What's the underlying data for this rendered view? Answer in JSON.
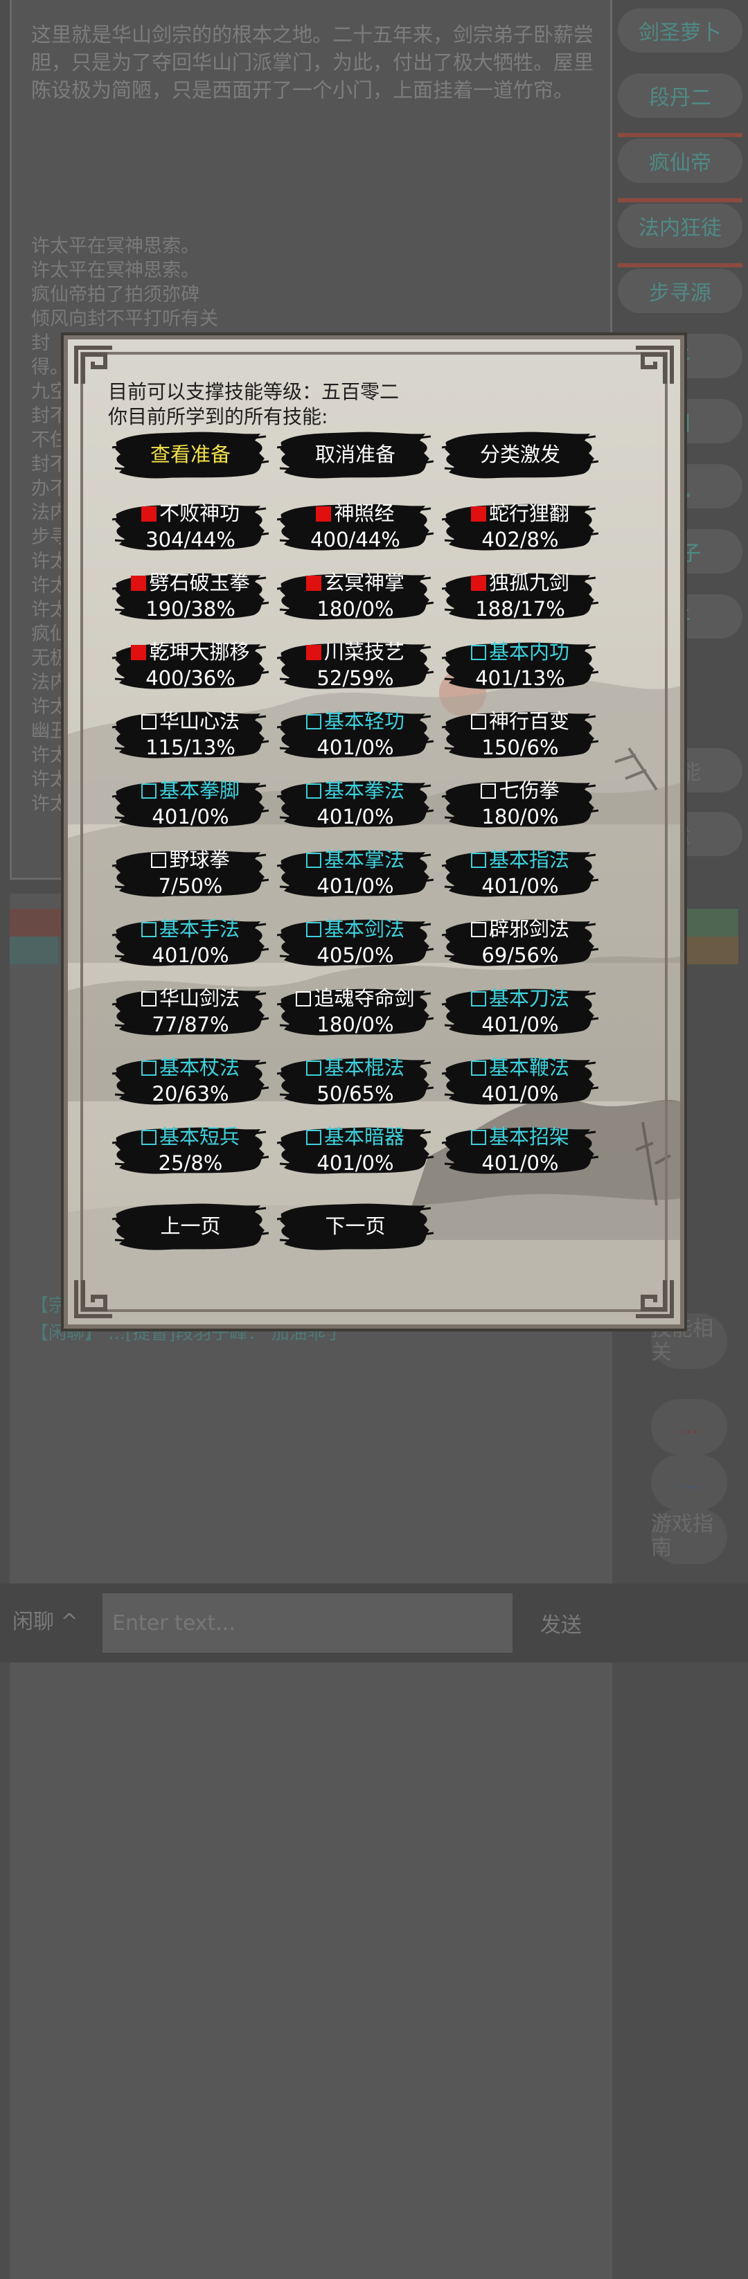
{
  "story": {
    "description": "这里就是华山剑宗的的根本之地。二十五年来，剑宗弟子卧薪尝胆，只是为了夺回华山门派掌门，为此，付出了极大牺牲。屋里陈设极为简陋，只是西面开了一个小门，上面挂着一道竹帘。",
    "log": [
      {
        "text": "许太平在冥神思索。",
        "tone": "normal"
      },
      {
        "text": "许太平在冥神思索。",
        "tone": "normal"
      },
      {
        "text": "疯仙帝拍了拍须弥碑",
        "tone": "normal"
      },
      {
        "text": "倾风向封不平打听有关",
        "tone": "normal"
      },
      {
        "text": "封",
        "tone": "normal"
      },
      {
        "text": "得。",
        "tone": "normal"
      },
      {
        "text": "九空",
        "tone": "normal"
      },
      {
        "text": "封不",
        "tone": "normal"
      },
      {
        "text": "不住",
        "tone": "normal"
      },
      {
        "text": "封不",
        "tone": "normal"
      },
      {
        "text": "办不",
        "tone": "normal"
      },
      {
        "text": "法内",
        "tone": "normal"
      },
      {
        "text": "步寻",
        "tone": "normal"
      },
      {
        "text": "许太",
        "tone": "normal"
      },
      {
        "text": "许太",
        "tone": "normal"
      },
      {
        "text": "许太",
        "tone": "normal"
      },
      {
        "text": "疯仙",
        "tone": "normal"
      },
      {
        "text": "无极",
        "tone": "normal"
      },
      {
        "text": "法内",
        "tone": "normal"
      },
      {
        "text": "许太",
        "tone": "normal"
      },
      {
        "text": "幽丑",
        "tone": "normal"
      },
      {
        "text": "许太",
        "tone": "normal"
      },
      {
        "text": "许太",
        "tone": "normal"
      },
      {
        "text": "许太",
        "tone": "normal"
      }
    ]
  },
  "sidebar": {
    "players": [
      "剑圣萝卜",
      "段丹二",
      "疯仙帝",
      "法内狂徒",
      "步寻源",
      "平",
      "田",
      "风",
      "洞子",
      "平"
    ],
    "more": [
      "功能",
      "遣"
    ]
  },
  "chat_lines": [
    "【宗",
    "【闲聊】 ...[提督]段羽子峰：  加油乖了"
  ],
  "right_menu": [
    {
      "label": "技能相关",
      "tone": "normal"
    },
    {
      "label": "...",
      "tone": "red"
    },
    {
      "label": "...",
      "tone": "blue"
    },
    {
      "label": "游戏指南",
      "tone": "normal"
    }
  ],
  "chat_bar": {
    "channel": "闲聊 ^",
    "placeholder": "Enter text...",
    "send": "发送"
  },
  "modal": {
    "support_line": "目前可以支撑技能等级：五百零二",
    "learned_line": "你目前所学到的所有技能:",
    "actions": [
      {
        "label": "查看准备",
        "color": "#f3e24a"
      },
      {
        "label": "取消准备",
        "color": "#ffffff"
      },
      {
        "label": "分类激发",
        "color": "#ffffff"
      }
    ],
    "skills": [
      {
        "name": "不败神功",
        "value": "304/44%",
        "mark": "filled",
        "basic": false
      },
      {
        "name": "神照经",
        "value": "400/44%",
        "mark": "filled",
        "basic": false
      },
      {
        "name": "蛇行狸翻",
        "value": "402/8%",
        "mark": "filled",
        "basic": false
      },
      {
        "name": "劈石破玉拳",
        "value": "190/38%",
        "mark": "filled",
        "basic": false
      },
      {
        "name": "玄冥神掌",
        "value": "180/0%",
        "mark": "filled",
        "basic": false
      },
      {
        "name": "独孤九剑",
        "value": "188/17%",
        "mark": "filled",
        "basic": false
      },
      {
        "name": "乾坤大挪移",
        "value": "400/36%",
        "mark": "filled",
        "basic": false
      },
      {
        "name": "川菜技艺",
        "value": "52/59%",
        "mark": "filled",
        "basic": false
      },
      {
        "name": "基本内功",
        "value": "401/13%",
        "mark": "empty",
        "basic": true
      },
      {
        "name": "华山心法",
        "value": "115/13%",
        "mark": "empty",
        "basic": false
      },
      {
        "name": "基本轻功",
        "value": "401/0%",
        "mark": "empty",
        "basic": true
      },
      {
        "name": "神行百变",
        "value": "150/6%",
        "mark": "empty",
        "basic": false
      },
      {
        "name": "基本拳脚",
        "value": "401/0%",
        "mark": "empty",
        "basic": true
      },
      {
        "name": "基本拳法",
        "value": "401/0%",
        "mark": "empty",
        "basic": true
      },
      {
        "name": "七伤拳",
        "value": "180/0%",
        "mark": "empty",
        "basic": false
      },
      {
        "name": "野球拳",
        "value": "7/50%",
        "mark": "empty",
        "basic": false
      },
      {
        "name": "基本掌法",
        "value": "401/0%",
        "mark": "empty",
        "basic": true
      },
      {
        "name": "基本指法",
        "value": "401/0%",
        "mark": "empty",
        "basic": true
      },
      {
        "name": "基本手法",
        "value": "401/0%",
        "mark": "empty",
        "basic": true
      },
      {
        "name": "基本剑法",
        "value": "405/0%",
        "mark": "empty",
        "basic": true
      },
      {
        "name": "辟邪剑法",
        "value": "69/56%",
        "mark": "empty",
        "basic": false
      },
      {
        "name": "华山剑法",
        "value": "77/87%",
        "mark": "empty",
        "basic": false
      },
      {
        "name": "追魂夺命剑",
        "value": "180/0%",
        "mark": "empty",
        "basic": false
      },
      {
        "name": "基本刀法",
        "value": "401/0%",
        "mark": "empty",
        "basic": true
      },
      {
        "name": "基本杖法",
        "value": "20/63%",
        "mark": "empty",
        "basic": true
      },
      {
        "name": "基本棍法",
        "value": "50/65%",
        "mark": "empty",
        "basic": true
      },
      {
        "name": "基本鞭法",
        "value": "401/0%",
        "mark": "empty",
        "basic": true
      },
      {
        "name": "基本短兵",
        "value": "25/8%",
        "mark": "empty",
        "basic": true
      },
      {
        "name": "基本暗器",
        "value": "401/0%",
        "mark": "empty",
        "basic": true
      },
      {
        "name": "基本招架",
        "value": "401/0%",
        "mark": "empty",
        "basic": true
      }
    ],
    "pager": {
      "prev": "上一页",
      "next": "下一页"
    }
  },
  "colors": {
    "filled_mark": "#e01010",
    "basic_skill": "#3fd0dc",
    "primary_action": "#f3e24a",
    "overlay": "#4d4d4d"
  }
}
